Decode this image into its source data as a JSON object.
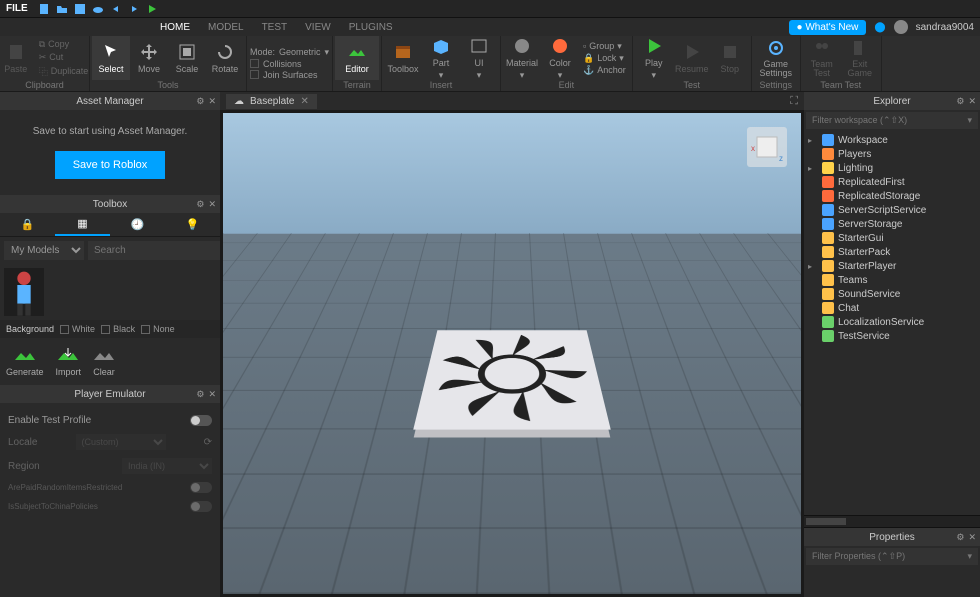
{
  "topbar": {
    "file": "FILE"
  },
  "menubar": {
    "tabs": [
      "HOME",
      "MODEL",
      "TEST",
      "VIEW",
      "PLUGINS"
    ],
    "active": "HOME",
    "whatsnew": "What's New",
    "user": "sandraa9004"
  },
  "ribbon": {
    "clipboard": {
      "label": "Clipboard",
      "paste": "Paste",
      "copy": "Copy",
      "cut": "Cut",
      "duplicate": "Duplicate"
    },
    "tools": {
      "label": "Tools",
      "select": "Select",
      "move": "Move",
      "scale": "Scale",
      "rotate": "Rotate"
    },
    "mode": {
      "label": "Mode:",
      "value": "Geometric",
      "collisions": "Collisions",
      "join": "Join Surfaces"
    },
    "terrain": {
      "label": "Terrain",
      "editor": "Editor"
    },
    "insert": {
      "label": "Insert",
      "toolbox": "Toolbox",
      "part": "Part",
      "ui": "UI"
    },
    "edit": {
      "label": "Edit",
      "material": "Material",
      "color": "Color",
      "group": "Group",
      "lock": "Lock",
      "anchor": "Anchor"
    },
    "test": {
      "label": "Test",
      "play": "Play",
      "resume": "Resume",
      "stop": "Stop"
    },
    "settings": {
      "label": "Settings",
      "game": "Game\nSettings"
    },
    "teamtest": {
      "label": "Team Test",
      "team": "Team\nTest",
      "exit": "Exit\nGame"
    }
  },
  "asset": {
    "title": "Asset Manager",
    "msg": "Save to start using Asset Manager.",
    "save": "Save to Roblox"
  },
  "toolbox": {
    "title": "Toolbox",
    "category": "My Models",
    "search_ph": "Search",
    "bg_label": "Background",
    "white": "White",
    "black": "Black",
    "none": "None",
    "generate": "Generate",
    "import": "Import",
    "clear": "Clear"
  },
  "emulator": {
    "title": "Player Emulator",
    "enable": "Enable Test Profile",
    "locale_label": "Locale",
    "locale_val": "(Custom)",
    "region_label": "Region",
    "region_val": "India (IN)",
    "policy1": "ArePaidRandomItemsRestricted",
    "policy2": "IsSubjectToChinaPolicies"
  },
  "viewport": {
    "tab": "Baseplate"
  },
  "explorer": {
    "title": "Explorer",
    "filter": "Filter workspace (⌃⇧X)",
    "items": [
      {
        "name": "Workspace",
        "color": "#4aa3ff",
        "exp": true
      },
      {
        "name": "Players",
        "color": "#ff8a3c"
      },
      {
        "name": "Lighting",
        "color": "#ffd24a",
        "exp": true
      },
      {
        "name": "ReplicatedFirst",
        "color": "#ff6a3c"
      },
      {
        "name": "ReplicatedStorage",
        "color": "#ff6a3c"
      },
      {
        "name": "ServerScriptService",
        "color": "#4aa3ff"
      },
      {
        "name": "ServerStorage",
        "color": "#4aa3ff"
      },
      {
        "name": "StarterGui",
        "color": "#ffc14a"
      },
      {
        "name": "StarterPack",
        "color": "#ffc14a"
      },
      {
        "name": "StarterPlayer",
        "color": "#ffc14a",
        "exp": true
      },
      {
        "name": "Teams",
        "color": "#ffc14a"
      },
      {
        "name": "SoundService",
        "color": "#ffc14a"
      },
      {
        "name": "Chat",
        "color": "#ffc14a"
      },
      {
        "name": "LocalizationService",
        "color": "#6ad06a"
      },
      {
        "name": "TestService",
        "color": "#6ad06a"
      }
    ]
  },
  "properties": {
    "title": "Properties",
    "filter": "Filter Properties (⌃⇧P)"
  }
}
